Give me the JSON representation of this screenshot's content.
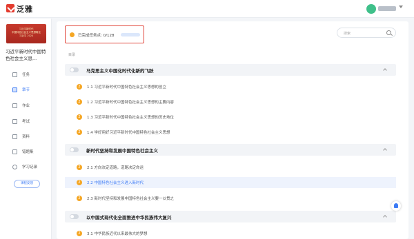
{
  "app": {
    "logo_text": "泛雅"
  },
  "user": {
    "avatar_text": ""
  },
  "course": {
    "cover_lines": [
      "习近平新时代",
      "中国特色社会主义思想概论",
      "习近平 2024"
    ],
    "title": "习近平新时代中国特色社会主义思..."
  },
  "sidebar": {
    "items": [
      {
        "label": "任务",
        "icon": "task-icon"
      },
      {
        "label": "章节",
        "icon": "chapter-icon",
        "active": true
      },
      {
        "label": "作业",
        "icon": "homework-icon"
      },
      {
        "label": "考试",
        "icon": "exam-icon"
      },
      {
        "label": "资料",
        "icon": "material-icon"
      },
      {
        "label": "错题集",
        "icon": "wrongbook-icon"
      },
      {
        "label": "学习记录",
        "icon": "record-icon"
      }
    ],
    "feedback_label": "课程反馈"
  },
  "progress": {
    "label": "已完成任务点: 0/128",
    "completed": 0,
    "total": 128
  },
  "search": {
    "placeholder": "搜索"
  },
  "toc_label": "目录",
  "chapters": [
    {
      "title": "马克思主义中国化时代化新的飞跃",
      "sections": [
        {
          "badge": "2",
          "title": "1.1 习近平新时代中国特色社会主义思想的创立"
        },
        {
          "badge": "2",
          "title": "1.2 习近平新时代中国特色社会主义思想的主要内容"
        },
        {
          "badge": "2",
          "title": "1.3 习近平新时代中国特色社会主义思想的历史地位"
        },
        {
          "badge": "2",
          "title": "1.4 学好用好习近平新时代中国特色社会主义思想"
        }
      ]
    },
    {
      "title": "新时代坚持和发展中国特色社会主义",
      "sections": [
        {
          "badge": "2",
          "title": "2.1 方向决定道路，道路决定命运"
        },
        {
          "badge": "2",
          "title": "2.2 中国特色社会主义进入新时代",
          "active": true
        },
        {
          "badge": "2",
          "title": "2.3 新时代坚持和发展中国特色社会主义要一以贯之"
        }
      ]
    },
    {
      "title": "以中国式现代化全面推进中华民族伟大复兴",
      "sections": [
        {
          "badge": "2",
          "title": "3.1 中华民族近代以来最伟大的梦想"
        }
      ]
    }
  ],
  "colors": {
    "accent": "#3d7bf5",
    "badge": "#f5a623",
    "highlight_border": "#e0453a"
  }
}
